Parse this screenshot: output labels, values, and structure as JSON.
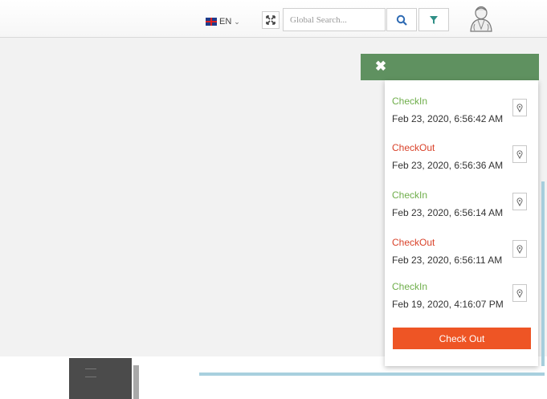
{
  "header": {
    "language_label": "EN",
    "search_placeholder": "Global Search...",
    "icons": {
      "language": "uk-flag-icon",
      "expand": "expand-arrows-icon",
      "search": "search-icon",
      "filter": "filter-icon",
      "user": "user-avatar-icon"
    }
  },
  "panel": {
    "close_icon": "close-icon",
    "entries": [
      {
        "status": "CheckIn",
        "timestamp": "Feb 23, 2020, 6:56:42 AM",
        "kind": "in"
      },
      {
        "status": "CheckOut",
        "timestamp": "Feb 23, 2020, 6:56:36 AM",
        "kind": "out"
      },
      {
        "status": "CheckIn",
        "timestamp": "Feb 23, 2020, 6:56:14 AM",
        "kind": "in"
      },
      {
        "status": "CheckOut",
        "timestamp": "Feb 23, 2020, 6:56:11 AM",
        "kind": "out"
      },
      {
        "status": "CheckIn",
        "timestamp": "Feb 19, 2020, 4:16:07 PM",
        "kind": "in"
      }
    ],
    "checkout_button": "Check Out"
  },
  "colors": {
    "panel_header": "#5f9160",
    "checkin": "#6fae4b",
    "checkout": "#d9422a",
    "checkout_button": "#ee5525"
  }
}
